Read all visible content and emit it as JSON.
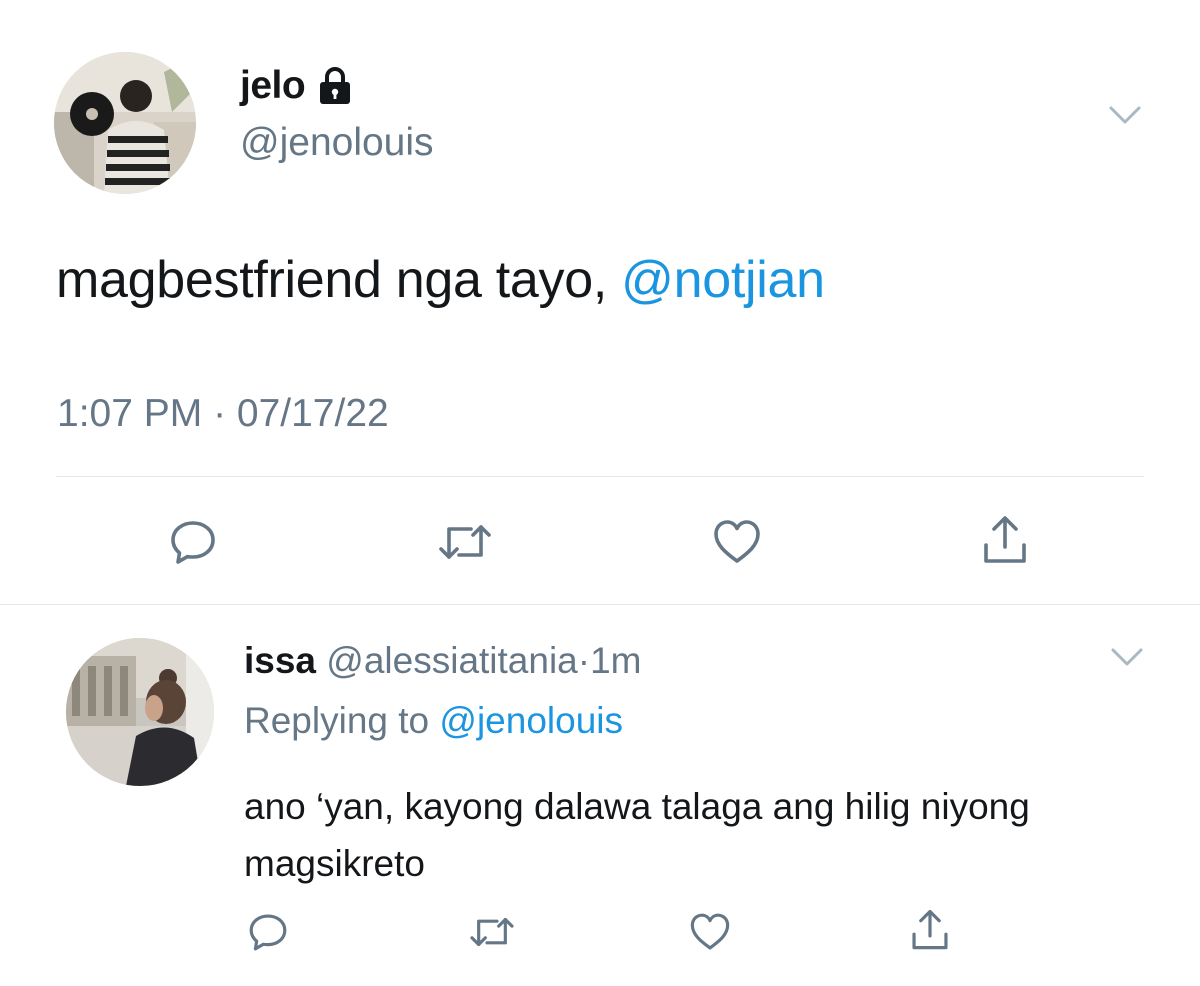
{
  "main_tweet": {
    "display_name": "jelo",
    "protected_icon": "lock-icon",
    "handle": "@jenolouis",
    "text_prefix": "magbestfriend nga tayo, ",
    "mention": "@notjian",
    "timestamp": "1:07 PM · 07/17/22",
    "actions": [
      "reply-icon",
      "retweet-icon",
      "like-icon",
      "share-icon"
    ]
  },
  "reply_tweet": {
    "display_name": "issa",
    "handle": "@alessiatitania",
    "separator": "·",
    "time": "1m",
    "replying_prefix": "Replying to ",
    "replying_to": "@jenolouis",
    "text": "ano ‘yan, kayong dalawa talaga ang hilig niyong magsikreto",
    "actions": [
      "reply-icon",
      "retweet-icon",
      "like-icon",
      "share-icon"
    ]
  },
  "colors": {
    "text": "#14171a",
    "secondary": "#657786",
    "link": "#1b95e0",
    "divider": "#e1e8ed",
    "icon": "#657786"
  }
}
